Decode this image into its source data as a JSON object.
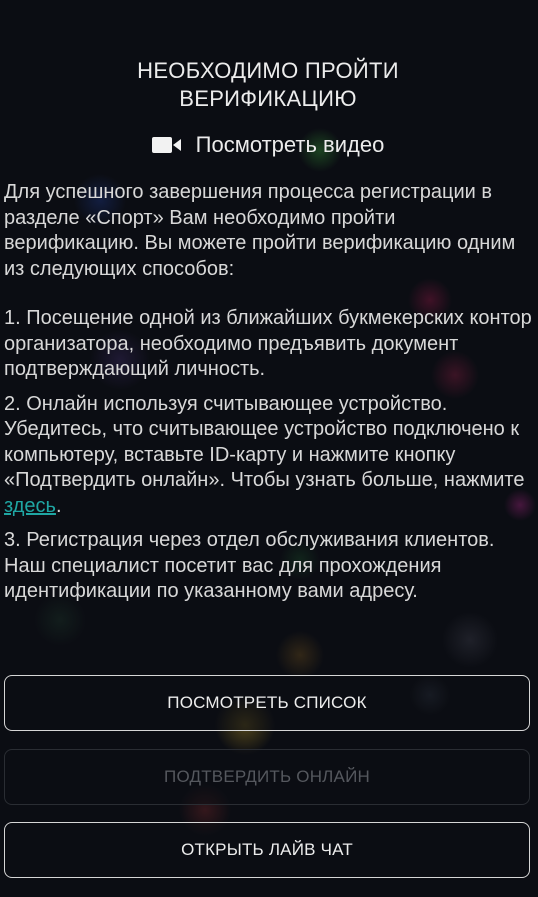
{
  "header": {
    "title_line1": "НЕОБХОДИМО ПРОЙТИ",
    "title_line2": "ВЕРИФИКАЦИЮ",
    "video_link_label": "Посмотреть видео",
    "video_icon": "video-camera-icon"
  },
  "body": {
    "intro": "Для успешного завершения процесса регистрации в разделе «Спорт» Вам необходимо пройти верификацию. Вы можете пройти верификацию одним из следующих способов:",
    "option1": "1. Посещение одной из ближайших букмекерских контор организатора, необходимо предъявить документ подтверждающий личность.",
    "option2_text": "2. Онлайн используя считывающее устройство. Убедитесь, что считывающее устройство подключено к компьютеру, вставьте ID-карту и нажмите кнопку «Подтвердить онлайн». Чтобы узнать больше, нажмите ",
    "option2_link": "здесь",
    "option2_end": ".",
    "option3": "3. Регистрация через отдел обслуживания клиентов. Наш специалист посетит вас для прохождения идентификации по указанному вами адресу."
  },
  "buttons": {
    "view_list": "ПОСМОТРЕТЬ СПИСОК",
    "confirm_online": "ПОДТВЕРДИТЬ ОНЛАЙН",
    "open_live_chat": "ОТКРЫТЬ ЛАЙВ ЧАТ"
  },
  "colors": {
    "background": "#0b0d13",
    "text": "#d8d8d8",
    "link": "#1fa6a3",
    "button_border": "#d6d6d6",
    "button_disabled_border": "#2a2d33",
    "button_disabled_text": "#55585e"
  }
}
